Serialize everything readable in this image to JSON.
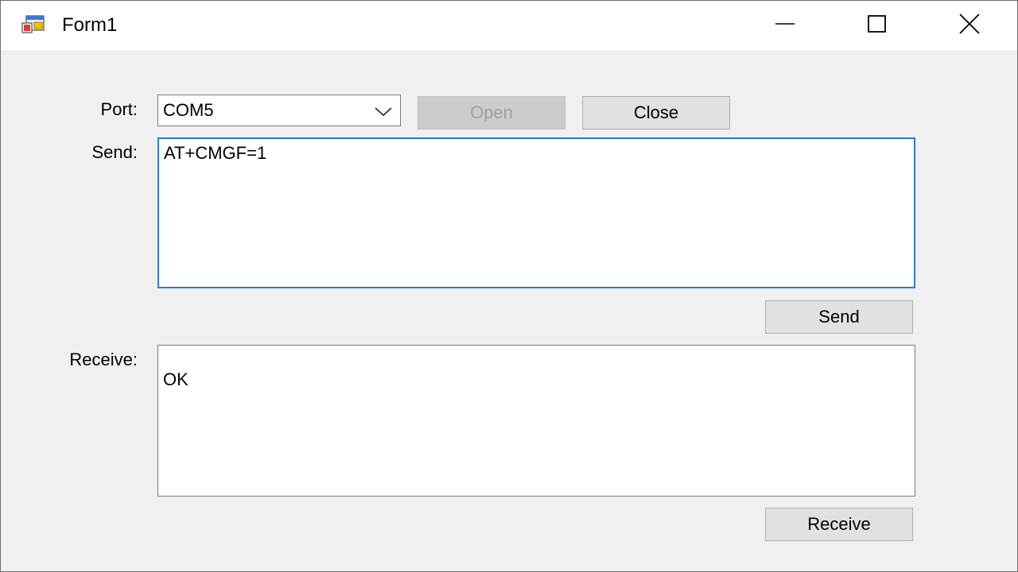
{
  "window": {
    "title": "Form1"
  },
  "titlebar": {
    "minimize_icon": "minimize-icon",
    "maximize_icon": "maximize-icon",
    "close_icon": "close-icon"
  },
  "port": {
    "label": "Port:",
    "selected": "COM5"
  },
  "buttons": {
    "open": "Open",
    "close": "Close",
    "send": "Send",
    "receive": "Receive"
  },
  "send": {
    "label": "Send:",
    "value": "AT+CMGF=1"
  },
  "receive": {
    "label": "Receive:",
    "value": "OK"
  },
  "colors": {
    "focus_border": "#2b7bd6",
    "button_face": "#e1e1e1",
    "disabled_text": "#a0a0a0"
  }
}
